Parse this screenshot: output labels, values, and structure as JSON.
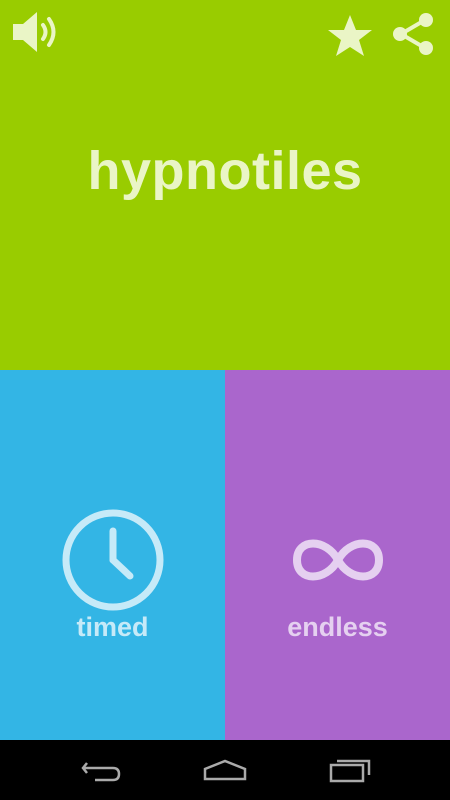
{
  "app": {
    "title": "hypnotiles"
  },
  "toolbar": {
    "sound_icon": "speaker-icon",
    "star_icon": "star-icon",
    "share_icon": "share-icon"
  },
  "modes": [
    {
      "label": "timed",
      "icon": "clock-icon",
      "color": "#33B5E5"
    },
    {
      "label": "endless",
      "icon": "infinity-icon",
      "color": "#AA66CC"
    }
  ],
  "colors": {
    "header": "#99CC00",
    "timed": "#33B5E5",
    "endless": "#AA66CC",
    "navbar": "#000000"
  },
  "navbar": {
    "back_icon": "back-icon",
    "home_icon": "home-icon",
    "recents_icon": "recents-icon"
  }
}
